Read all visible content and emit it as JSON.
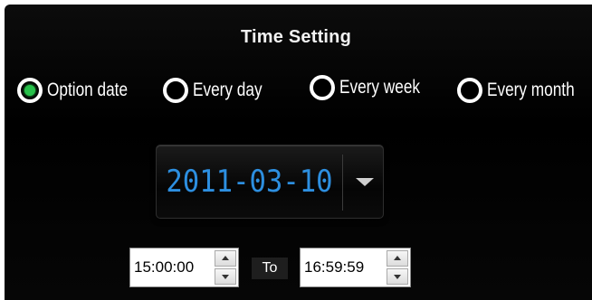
{
  "title": "Time Setting",
  "schedule_options": [
    {
      "label": "Option date",
      "checked": true
    },
    {
      "label": "Every day",
      "checked": false
    },
    {
      "label": "Every week",
      "checked": false
    },
    {
      "label": "Every month",
      "checked": false
    }
  ],
  "date_picker": {
    "value": "2011-03-10",
    "text_color": "#2d8fe0"
  },
  "time_range": {
    "start": "15:00:00",
    "separator": "To",
    "end": "16:59:59"
  },
  "colors": {
    "background": "#000000",
    "radio_selected": "#27c04a",
    "text": "#ffffff"
  }
}
